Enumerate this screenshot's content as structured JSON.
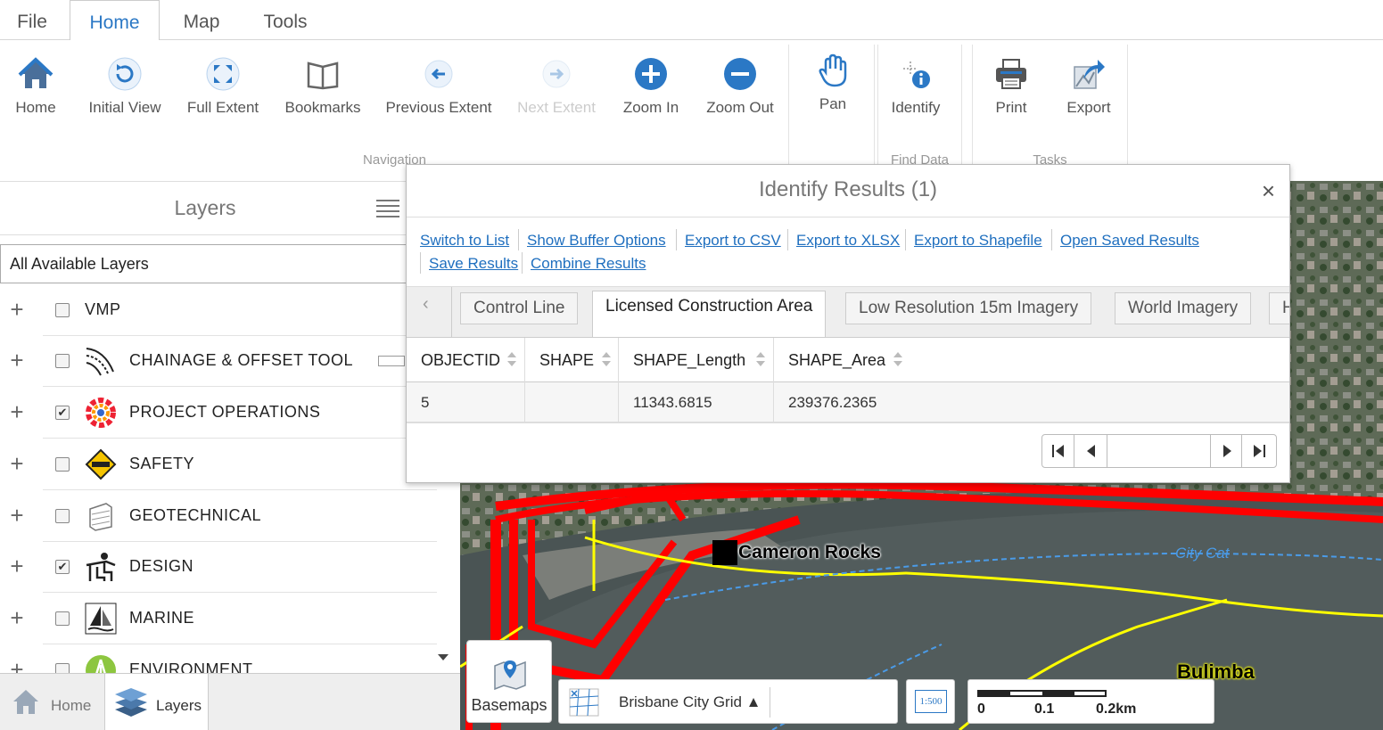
{
  "menu": {
    "tabs": [
      {
        "label": "File"
      },
      {
        "label": "Home",
        "active": true
      },
      {
        "label": "Map"
      },
      {
        "label": "Tools"
      }
    ]
  },
  "ribbon": {
    "navigation": {
      "label": "Navigation",
      "tools": [
        {
          "label": "Home",
          "icon": "home-icon"
        },
        {
          "label": "Initial View",
          "icon": "initial-view-icon"
        },
        {
          "label": "Full Extent",
          "icon": "full-extent-icon"
        },
        {
          "label": "Bookmarks",
          "icon": "bookmarks-icon"
        },
        {
          "label": "Previous Extent",
          "icon": "previous-extent-icon"
        },
        {
          "label": "Next Extent",
          "icon": "next-extent-icon",
          "disabled": true
        },
        {
          "label": "Zoom In",
          "icon": "zoom-in-icon"
        },
        {
          "label": "Zoom Out",
          "icon": "zoom-out-icon"
        }
      ]
    },
    "pan": {
      "label": "Pan",
      "icon": "pan-icon"
    },
    "find_data": {
      "label": "Find Data",
      "identify_label": "Identify"
    },
    "tasks": {
      "label": "Tasks",
      "print_label": "Print",
      "export_label": "Export"
    }
  },
  "layers_panel": {
    "title": "Layers",
    "filter_value": "All Available Layers",
    "items": [
      {
        "name": "VMP",
        "checked": false,
        "icon": ""
      },
      {
        "name": "CHAINAGE & OFFSET TOOL",
        "checked": false,
        "icon": "chainage-icon"
      },
      {
        "name": "PROJECT OPERATIONS",
        "checked": true,
        "icon": "project-operations-icon"
      },
      {
        "name": "SAFETY",
        "checked": false,
        "icon": "safety-sign-icon"
      },
      {
        "name": "GEOTECHNICAL",
        "checked": false,
        "icon": "geotechnical-icon"
      },
      {
        "name": "DESIGN",
        "checked": true,
        "icon": "design-icon"
      },
      {
        "name": "MARINE",
        "checked": false,
        "icon": "marine-icon"
      },
      {
        "name": "ENVIRONMENT",
        "checked": false,
        "icon": "environment-icon"
      }
    ],
    "plus_symbol": "+",
    "check_mark": "✔"
  },
  "bottom_tabs": [
    {
      "label": "Home"
    },
    {
      "label": "Layers",
      "active": true
    }
  ],
  "identify": {
    "title": "Identify Results (1)",
    "close_symbol": "×",
    "links": [
      "Switch to List",
      "Show Buffer Options",
      "Export to CSV",
      "Export to XLSX",
      "Export to Shapefile",
      "Open Saved Results",
      "Save Results",
      "Combine Results"
    ],
    "tabs": [
      {
        "label": "Control Line"
      },
      {
        "label": "Licensed Construction Area",
        "active": true
      },
      {
        "label": "Low Resolution 15m Imagery"
      },
      {
        "label": "World Imagery"
      },
      {
        "label": "High Resolution"
      }
    ],
    "columns": [
      "OBJECTID",
      "SHAPE",
      "SHAPE_Length",
      "SHAPE_Area"
    ],
    "rows": [
      [
        "5",
        "",
        "11343.6815",
        "239376.2365"
      ]
    ]
  },
  "map": {
    "labels": [
      "Cameron Rocks",
      "City Cat",
      "Bulimba"
    ],
    "basemaps_label": "Basemaps",
    "grid_label": "Brisbane City Grid ▲",
    "scale_button_label": "1:500",
    "scale_ticks": [
      "0",
      "0.1",
      "0.2km"
    ]
  },
  "colors": {
    "accent": "#2b78c5",
    "link": "#1f6fbf",
    "boundary_red": "#ff0000",
    "road_yellow": "#ffff00"
  }
}
